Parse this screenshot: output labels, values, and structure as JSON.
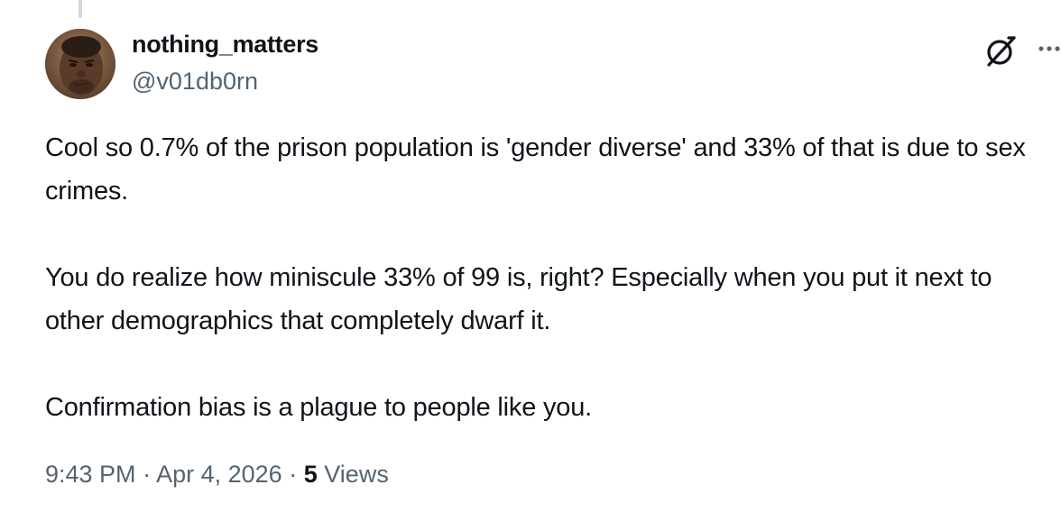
{
  "author": {
    "display_name": "nothing_matters",
    "handle": "@v01db0rn"
  },
  "tweet": {
    "paragraphs": [
      "Cool so 0.7% of the prison population is 'gender diverse' and 33% of that is due to sex crimes.",
      "You do realize how miniscule 33% of 99 is, right? Especially when you put it next to other demographics that completely dwarf it.",
      "Confirmation bias is a plague to people like you."
    ]
  },
  "meta": {
    "time": "9:43 PM",
    "separator": "·",
    "date": "Apr 4, 2026",
    "views_count": "5",
    "views_label": "Views"
  },
  "icons": {
    "avatar": "avatar-photo",
    "grok": "grok-icon",
    "more": "more-icon"
  },
  "colors": {
    "text_primary": "#0f1419",
    "text_secondary": "#536471",
    "thread_line": "#cfd9de",
    "background": "#ffffff"
  }
}
